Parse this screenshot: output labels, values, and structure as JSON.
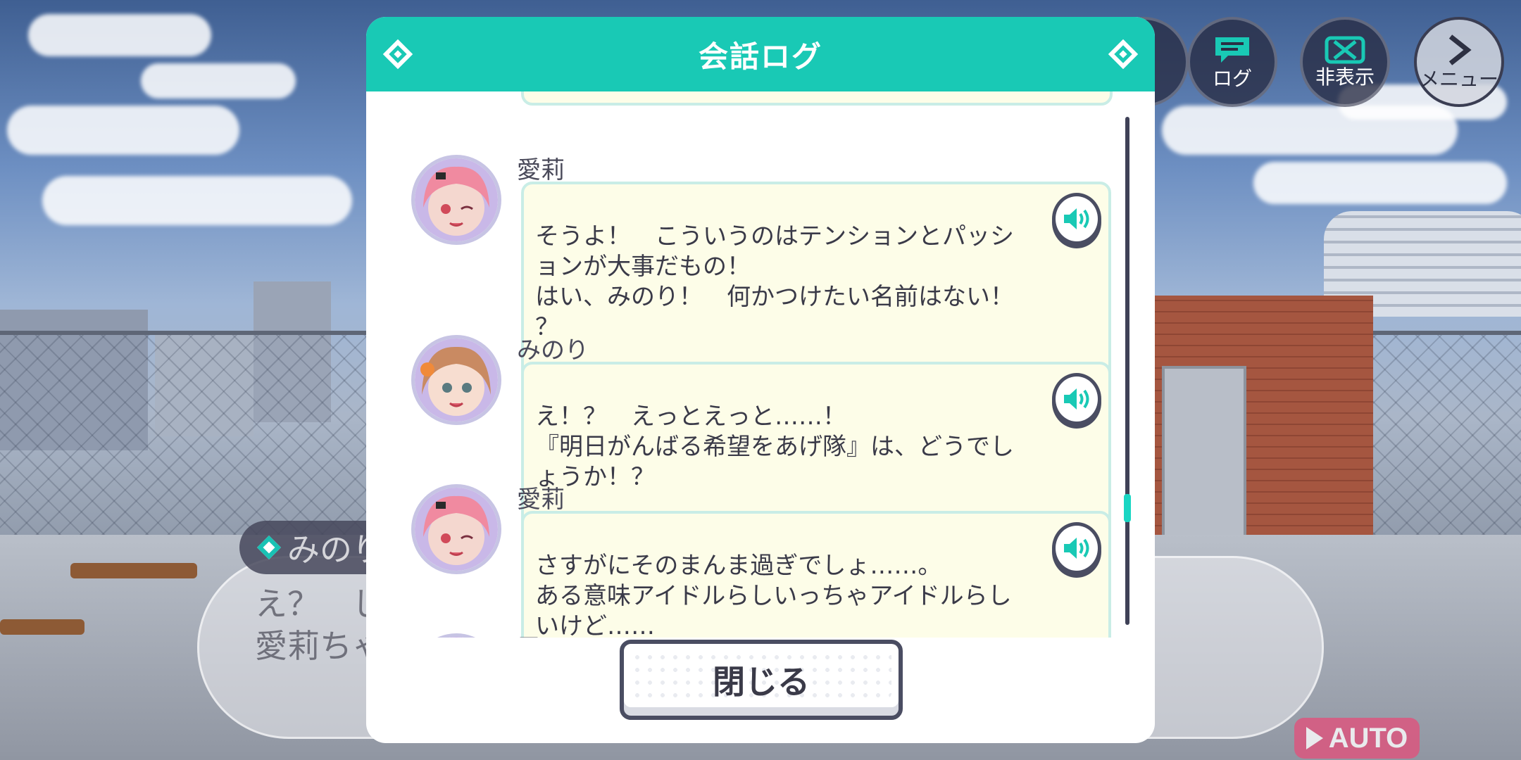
{
  "background": {
    "speaker_name": "みのり",
    "dialogue_text": "え？　じ\n愛莉ちゃ",
    "auto_label": "AUTO"
  },
  "controls": {
    "log_label": "ログ",
    "hide_label": "非表示",
    "menu_label": "メニュー"
  },
  "modal": {
    "title": "会話ログ",
    "close_label": "閉じる",
    "entries": [
      {
        "speaker": "愛莉",
        "text": "そうよ！　こういうのはテンションとパッシ\nョンが大事だもの！\nはい、みのり！　何かつけたい名前はない！\n？"
      },
      {
        "speaker": "みのり",
        "text": "え！？　えっとえっと……！\n『明日がんばる希望をあげ隊』は、どうでし\nょうか！？"
      },
      {
        "speaker": "愛莉",
        "text": "さすがにそのまんま過ぎでしょ……。\nある意味アイドルらしいっちゃアイドルらし\nいけど……"
      },
      {
        "speaker": "雫",
        "text": ""
      }
    ]
  },
  "colors": {
    "accent": "#19c9b5",
    "bubble_bg": "#fdfde8",
    "bubble_border": "#c9ede6",
    "dark": "#4a4d62",
    "auto": "#e0537d"
  }
}
